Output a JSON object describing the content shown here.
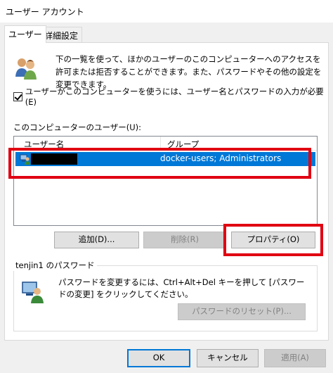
{
  "window": {
    "title": "ユーザー アカウント"
  },
  "tabs": [
    {
      "label": "ユーザー"
    },
    {
      "label": "詳細設定"
    }
  ],
  "intro": {
    "icon": "users-icon",
    "text": "下の一覧を使って、ほかのユーザーのこのコンピューターへのアクセスを許可または拒否することができます。また、パスワードやその他の設定を変更できます。"
  },
  "require_login": {
    "label": "ユーザーがこのコンピューターを使うには、ユーザー名とパスワードの入力が必要(E)",
    "checked": true
  },
  "users_list": {
    "label": "このコンピューターのユーザー(U):",
    "columns": [
      "ユーザー名",
      "グループ"
    ],
    "rows": [
      {
        "username": "",
        "group": "docker-users; Administrators",
        "selected": true
      }
    ]
  },
  "buttons": {
    "add": "追加(D)...",
    "remove": "削除(R)",
    "properties": "プロパティ(O)"
  },
  "password_group": {
    "title": "tenjin1 のパスワード",
    "icon": "password-user-icon",
    "text": "パスワードを変更するには、Ctrl+Alt+Del キーを押して [パスワードの変更] をクリックしてください。",
    "reset_button": "パスワードのリセット(P)..."
  },
  "dialog_buttons": {
    "ok": "OK",
    "cancel": "キャンセル",
    "apply": "適用(A)"
  },
  "colors": {
    "selection": "#0078d7",
    "highlight": "#e00012"
  }
}
